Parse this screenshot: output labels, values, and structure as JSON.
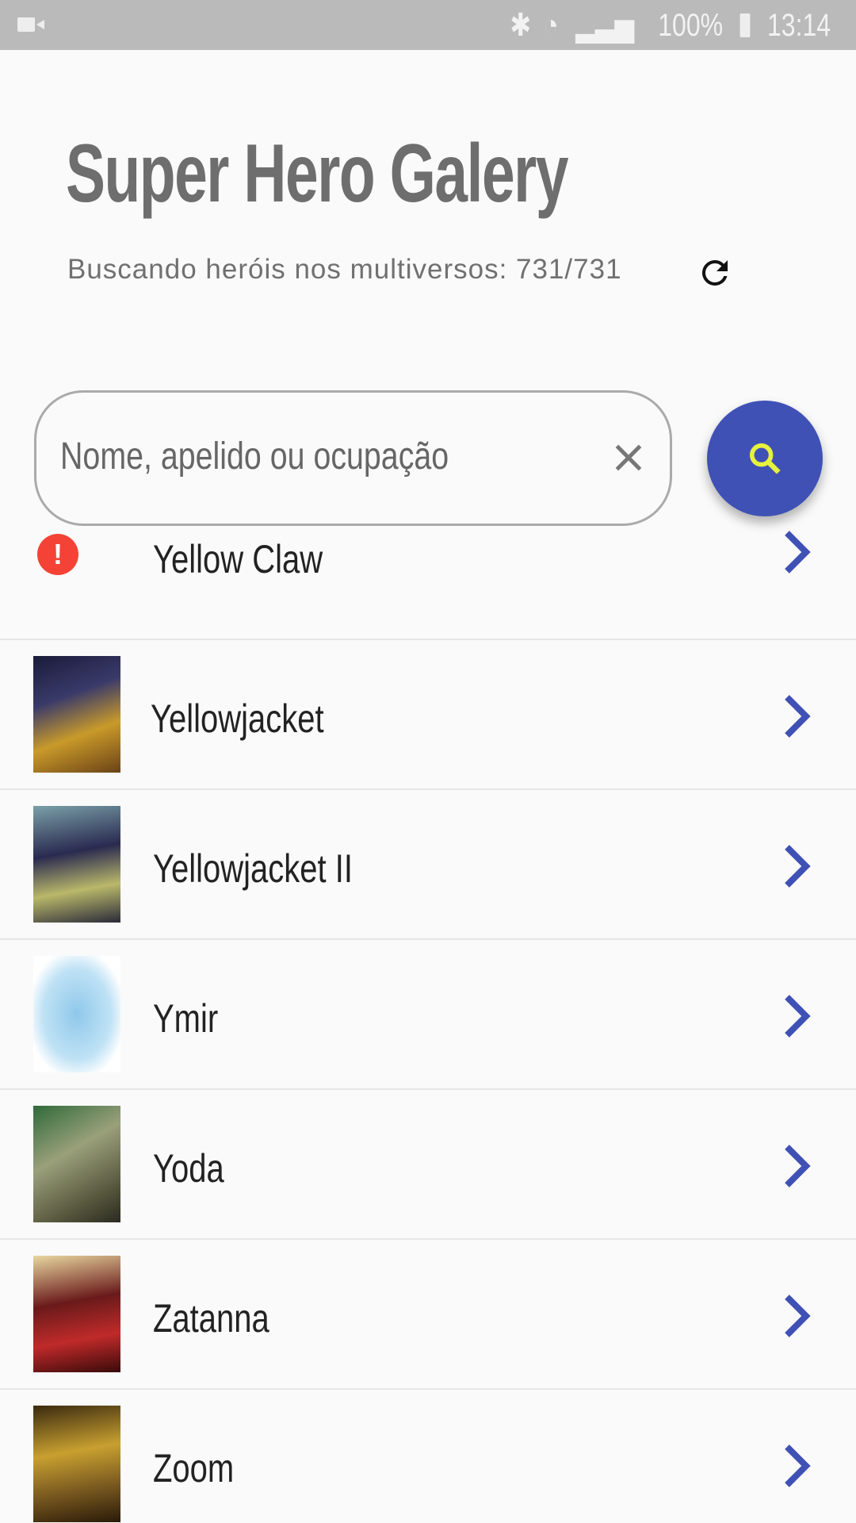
{
  "status_bar": {
    "battery": "100%",
    "time": "13:14"
  },
  "header": {
    "title": "Super Hero Galery",
    "progress_text": "Buscando heróis nos multiversos: 731/731"
  },
  "search": {
    "placeholder": "Nome, apelido ou ocupação",
    "value": ""
  },
  "colors": {
    "accent": "#3f51b5",
    "fab_icon": "#e6f23c",
    "error": "#f44336"
  },
  "heroes": [
    {
      "name": "Yellow Claw",
      "image": "error"
    },
    {
      "name": "Yellowjacket"
    },
    {
      "name": "Yellowjacket II"
    },
    {
      "name": "Ymir"
    },
    {
      "name": "Yoda"
    },
    {
      "name": "Zatanna"
    },
    {
      "name": "Zoom"
    }
  ]
}
